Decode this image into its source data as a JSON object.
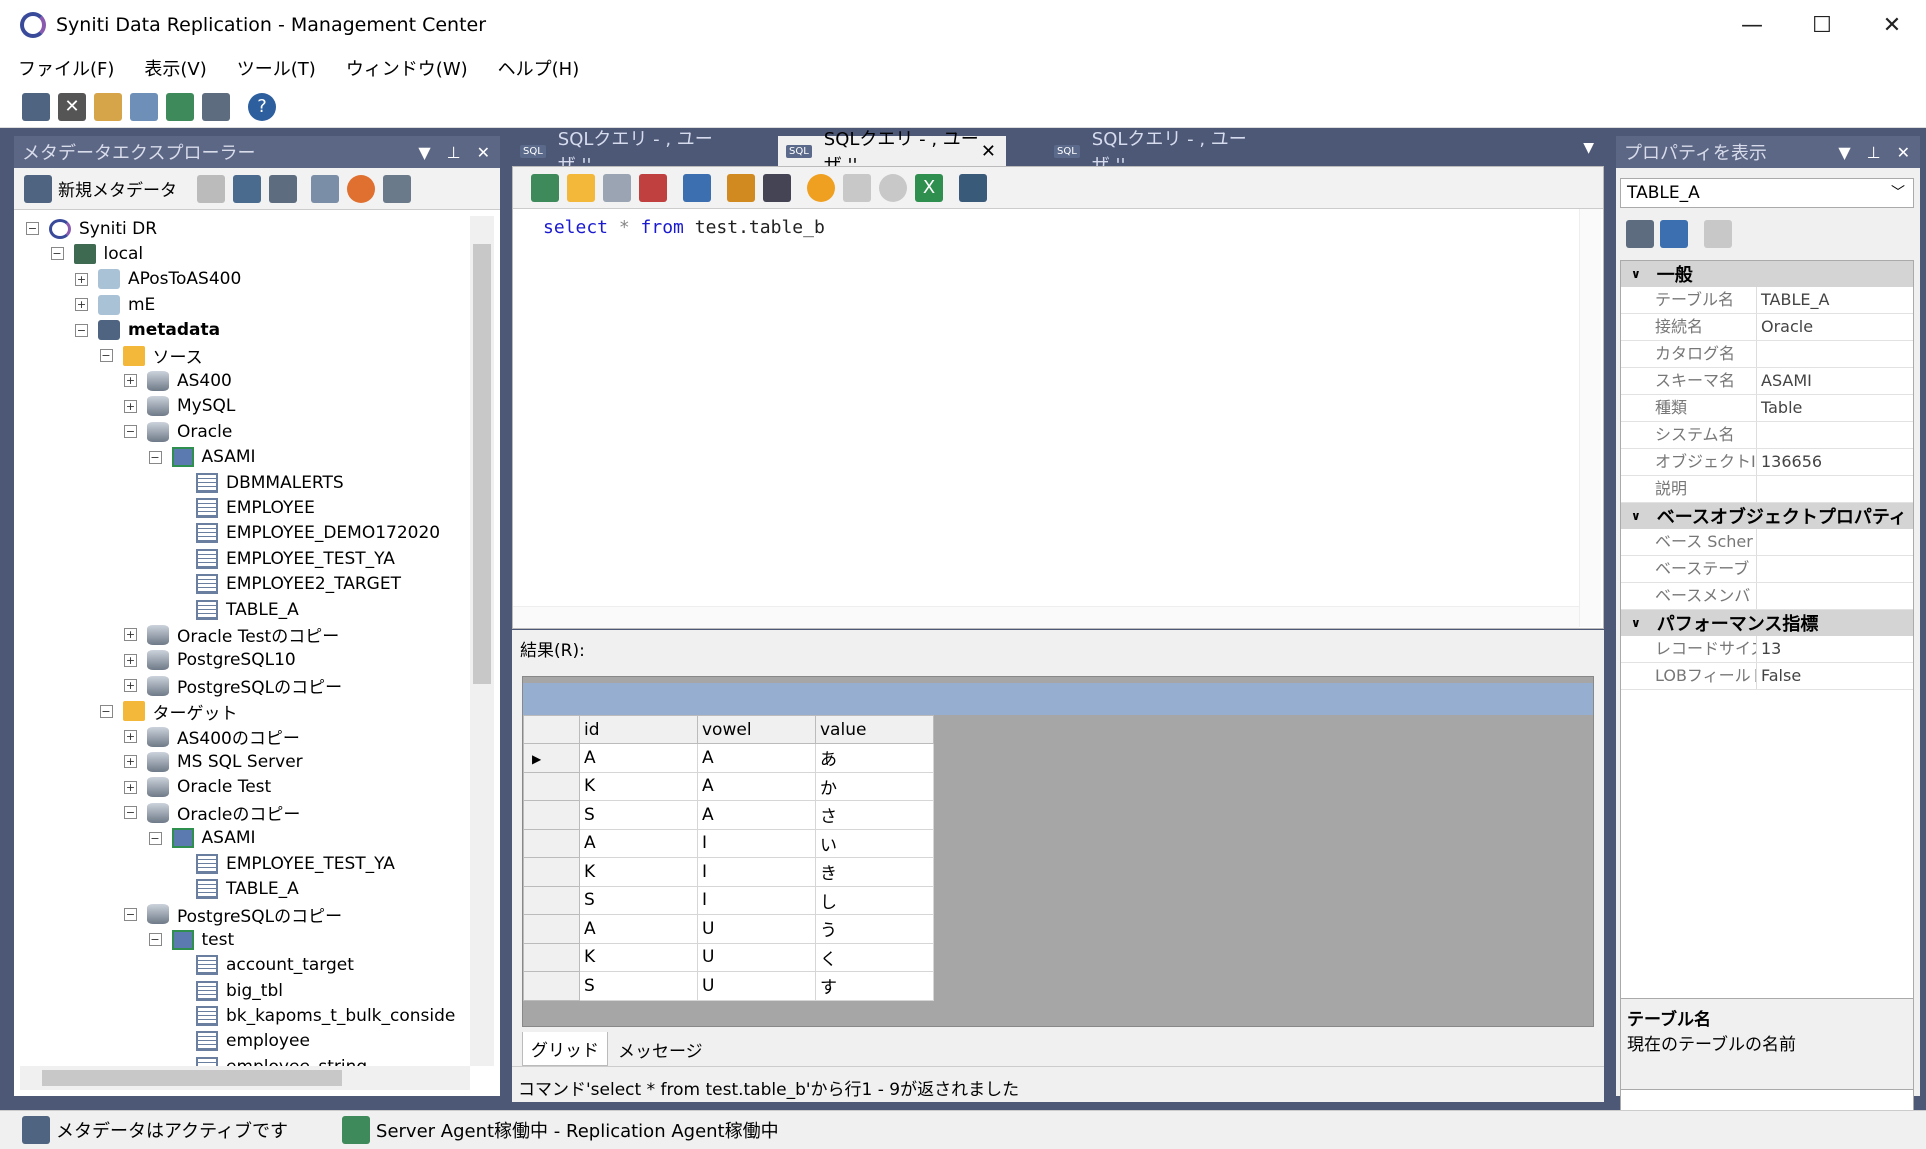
{
  "window": {
    "title": "Syniti Data Replication - Management Center",
    "minimize": "—",
    "maximize": "☐",
    "close": "✕"
  },
  "menu": [
    "ファイル(F)",
    "表示(V)",
    "ツール(T)",
    "ウィンドウ(W)",
    "ヘルプ(H)"
  ],
  "explorer": {
    "title": "メタデータエクスプローラー",
    "new_metadata": "新規メタデータ",
    "tree": [
      {
        "label": "Syniti DR",
        "level": 0,
        "icon": "root",
        "exp": "-"
      },
      {
        "label": "local",
        "level": 1,
        "icon": "server",
        "exp": "-"
      },
      {
        "label": "APosToAS400",
        "level": 2,
        "icon": "cube-l",
        "exp": "+"
      },
      {
        "label": "mE",
        "level": 2,
        "icon": "cube-l",
        "exp": "+"
      },
      {
        "label": "metadata",
        "level": 2,
        "icon": "cube",
        "exp": "-",
        "bold": true
      },
      {
        "label": "ソース",
        "level": 3,
        "icon": "folder",
        "exp": "-"
      },
      {
        "label": "AS400",
        "level": 4,
        "icon": "db",
        "exp": "+"
      },
      {
        "label": "MySQL",
        "level": 4,
        "icon": "db",
        "exp": "+"
      },
      {
        "label": "Oracle",
        "level": 4,
        "icon": "db",
        "exp": "-"
      },
      {
        "label": "ASAMI",
        "level": 5,
        "icon": "schema",
        "exp": "-"
      },
      {
        "label": "DBMMALERTS",
        "level": 6,
        "icon": "table"
      },
      {
        "label": "EMPLOYEE",
        "level": 6,
        "icon": "table"
      },
      {
        "label": "EMPLOYEE_DEMO172020",
        "level": 6,
        "icon": "table"
      },
      {
        "label": "EMPLOYEE_TEST_YA",
        "level": 6,
        "icon": "table"
      },
      {
        "label": "EMPLOYEE2_TARGET",
        "level": 6,
        "icon": "table"
      },
      {
        "label": "TABLE_A",
        "level": 6,
        "icon": "table"
      },
      {
        "label": "Oracle Testのコピー",
        "level": 4,
        "icon": "db",
        "exp": "+"
      },
      {
        "label": "PostgreSQL10",
        "level": 4,
        "icon": "db",
        "exp": "+"
      },
      {
        "label": "PostgreSQLのコピー",
        "level": 4,
        "icon": "db",
        "exp": "+"
      },
      {
        "label": "ターゲット",
        "level": 3,
        "icon": "folder",
        "exp": "-"
      },
      {
        "label": "AS400のコピー",
        "level": 4,
        "icon": "db",
        "exp": "+"
      },
      {
        "label": "MS SQL Server",
        "level": 4,
        "icon": "db",
        "exp": "+"
      },
      {
        "label": "Oracle Test",
        "level": 4,
        "icon": "db",
        "exp": "+"
      },
      {
        "label": "Oracleのコピー",
        "level": 4,
        "icon": "db",
        "exp": "-"
      },
      {
        "label": "ASAMI",
        "level": 5,
        "icon": "schema",
        "exp": "-"
      },
      {
        "label": "EMPLOYEE_TEST_YA",
        "level": 6,
        "icon": "table"
      },
      {
        "label": "TABLE_A",
        "level": 6,
        "icon": "table"
      },
      {
        "label": "PostgreSQLのコピー",
        "level": 4,
        "icon": "db",
        "exp": "-"
      },
      {
        "label": "test",
        "level": 5,
        "icon": "schema",
        "exp": "-"
      },
      {
        "label": "account_target",
        "level": 6,
        "icon": "table"
      },
      {
        "label": "big_tbl",
        "level": 6,
        "icon": "table"
      },
      {
        "label": "bk_kapoms_t_bulk_conside",
        "level": 6,
        "icon": "table"
      },
      {
        "label": "employee",
        "level": 6,
        "icon": "table"
      },
      {
        "label": "employee_string",
        "level": 6,
        "icon": "table"
      }
    ]
  },
  "tabs": [
    {
      "label": "SQLクエリ - , ユーザ ''",
      "active": false
    },
    {
      "label": "SQLクエリ - , ユーザ ''",
      "active": true
    },
    {
      "label": "SQLクエリ - , ユーザ ''",
      "active": false
    }
  ],
  "sql_badge": "SQL",
  "editor": {
    "kw1": "select",
    "mid": " * ",
    "kw2": "from",
    "rest": " test.table_b"
  },
  "results": {
    "label": "結果(R):",
    "columns": [
      "id",
      "vowel",
      "value"
    ],
    "rows": [
      [
        "A",
        "A",
        "あ"
      ],
      [
        "K",
        "A",
        "か"
      ],
      [
        "S",
        "A",
        "さ"
      ],
      [
        "A",
        "I",
        "い"
      ],
      [
        "K",
        "I",
        "き"
      ],
      [
        "S",
        "I",
        "し"
      ],
      [
        "A",
        "U",
        "う"
      ],
      [
        "K",
        "U",
        "く"
      ],
      [
        "S",
        "U",
        "す"
      ]
    ],
    "tabs": [
      "グリッド",
      "メッセージ"
    ],
    "status": "コマンド'select * from test.table_b'から行1 - 9が返されました"
  },
  "properties": {
    "title": "プロパティを表示",
    "selected": "TABLE_A",
    "categories": [
      {
        "name": "一般",
        "rows": [
          [
            "テーブル名",
            "TABLE_A"
          ],
          [
            "接続名",
            "Oracle"
          ],
          [
            "カタログ名",
            ""
          ],
          [
            "スキーマ名",
            "ASAMI"
          ],
          [
            "種類",
            "Table"
          ],
          [
            "システム名",
            ""
          ],
          [
            "オブジェクトID",
            "136656"
          ],
          [
            "説明",
            ""
          ]
        ]
      },
      {
        "name": "ベースオブジェクトプロパティ",
        "rows": [
          [
            "ベース Scher",
            ""
          ],
          [
            "ベーステーブ",
            ""
          ],
          [
            "ベースメンバ",
            ""
          ]
        ]
      },
      {
        "name": "パフォーマンス指標",
        "rows": [
          [
            "レコードサイズ",
            "13"
          ],
          [
            "LOBフィールド",
            "False"
          ]
        ]
      }
    ],
    "desc_title": "テーブル名",
    "desc_text": "現在のテーブルの名前"
  },
  "statusbar": {
    "metadata": "メタデータはアクティブです",
    "agents": "Server Agent稼働中 - Replication Agent稼働中"
  }
}
